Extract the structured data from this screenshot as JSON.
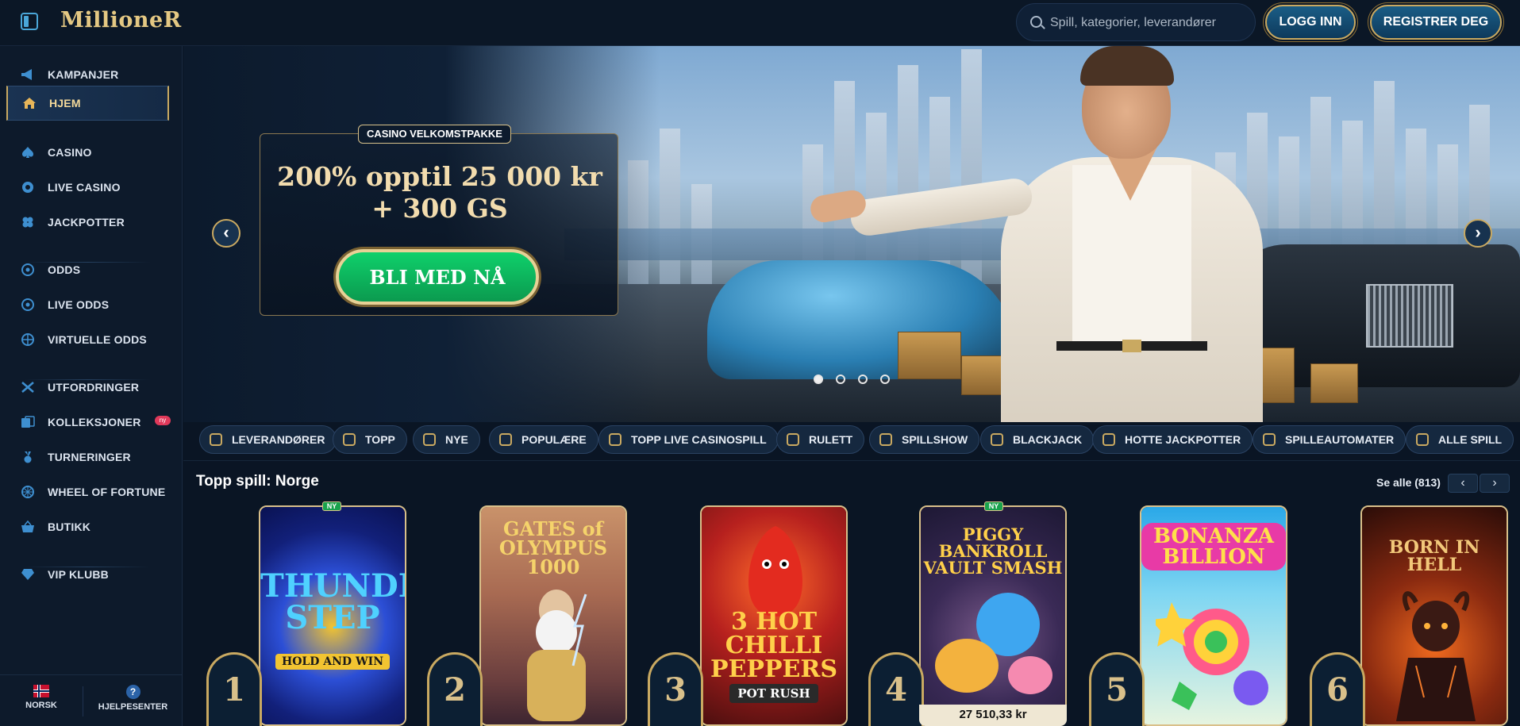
{
  "header": {
    "logo_text": "MillioneR",
    "search_placeholder": "Spill, kategorier, leverandører",
    "login_label": "LOGG INN",
    "register_label": "REGISTRER DEG"
  },
  "sidebar": {
    "items": [
      {
        "label": "KAMPANJER",
        "icon": "megaphone-icon"
      },
      {
        "label": "HJEM",
        "icon": "home-icon",
        "active": true
      },
      {
        "label": "CASINO",
        "icon": "spade-icon"
      },
      {
        "label": "LIVE CASINO",
        "icon": "chip-icon"
      },
      {
        "label": "JACKPOTTER",
        "icon": "clover-icon"
      },
      {
        "label": "ODDS",
        "icon": "soccer-ball-icon"
      },
      {
        "label": "LIVE ODDS",
        "icon": "live-ball-icon"
      },
      {
        "label": "VIRTUELLE ODDS",
        "icon": "virtual-ball-icon"
      },
      {
        "label": "UTFORDRINGER",
        "icon": "swords-icon"
      },
      {
        "label": "KOLLEKSJONER",
        "icon": "collections-icon",
        "badge": "ny"
      },
      {
        "label": "TURNERINGER",
        "icon": "medal-icon"
      },
      {
        "label": "WHEEL OF FORTUNE",
        "icon": "wheel-icon"
      },
      {
        "label": "BUTIKK",
        "icon": "basket-icon"
      },
      {
        "label": "VIP KLUBB",
        "icon": "diamond-icon"
      }
    ],
    "footer": {
      "language_label": "NORSK",
      "help_label": "HJELPESENTER",
      "help_icon_glyph": "?"
    }
  },
  "banner": {
    "tag": "CASINO VELKOMSTPAKKE",
    "title_line1": "200% opptil 25 000 kr",
    "title_line2": "+ 300 GS",
    "cta_label": "BLI MED NÅ",
    "prev_glyph": "‹",
    "next_glyph": "›",
    "slides_total": 4,
    "active_slide": 1
  },
  "categories": [
    {
      "label": "LEVERANDØRER",
      "icon": "book-icon"
    },
    {
      "label": "TOPP",
      "icon": "crown-icon"
    },
    {
      "label": "NYE",
      "icon": "lightning-icon"
    },
    {
      "label": "POPULÆRE",
      "icon": "fire-icon"
    },
    {
      "label": "TOPP LIVE CASINOSPILL",
      "icon": "star-icon"
    },
    {
      "label": "RULETT",
      "icon": "roulette-icon"
    },
    {
      "label": "SPILLSHOW",
      "icon": "microphone-icon"
    },
    {
      "label": "BLACKJACK",
      "icon": "cards-icon"
    },
    {
      "label": "HOTTE JACKPOTTER",
      "icon": "chili-icon"
    },
    {
      "label": "SPILLEAUTOMATER",
      "icon": "slot-machine-icon"
    },
    {
      "label": "ALLE SPILL",
      "icon": "all-games-icon"
    }
  ],
  "section": {
    "title": "Topp spill: Norge",
    "see_all": "Se alle (813)",
    "prev_glyph": "‹",
    "next_glyph": "›"
  },
  "games": [
    {
      "rank": "1",
      "title": "THUNDER STEP",
      "subtitle": "HOLD AND WIN",
      "badge": "NY"
    },
    {
      "rank": "2",
      "title": "GATES of OLYMPUS 1000",
      "subtitle": ""
    },
    {
      "rank": "3",
      "title": "3 HOT CHILLI PEPPERS",
      "subtitle": "POT RUSH"
    },
    {
      "rank": "4",
      "title": "PIGGY BANKROLL VAULT SMASH",
      "subtitle": "",
      "badge": "NY",
      "jackpot": "27 510,33 kr"
    },
    {
      "rank": "5",
      "title": "BONANZA BILLION",
      "subtitle": ""
    },
    {
      "rank": "6",
      "title": "BORN IN HELL",
      "subtitle": ""
    }
  ]
}
